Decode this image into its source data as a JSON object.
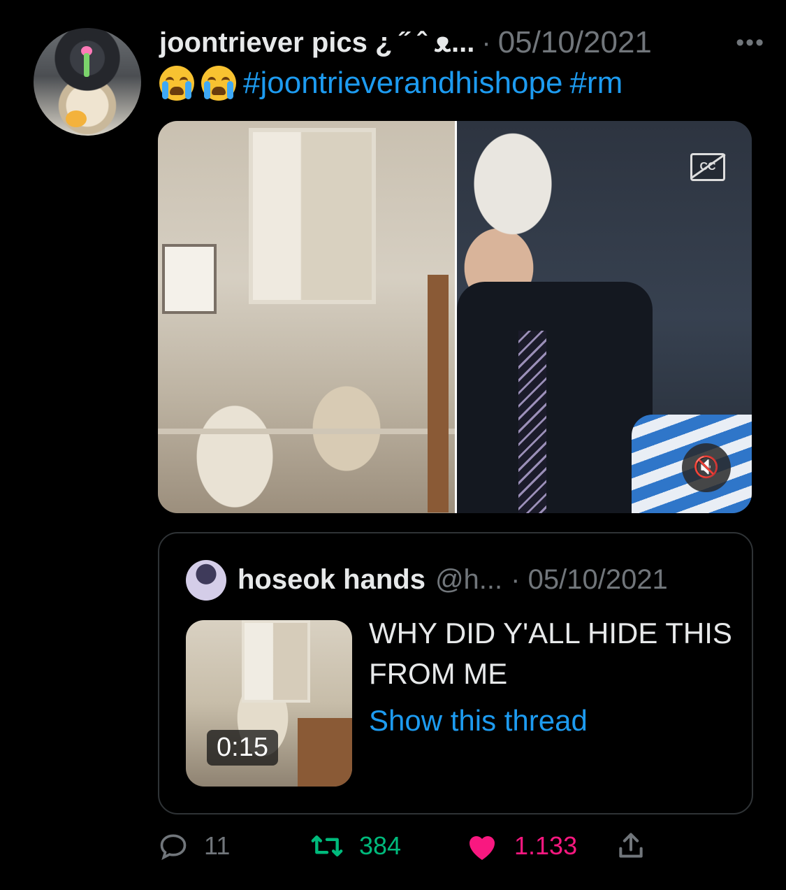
{
  "tweet": {
    "display_name": "joontriever pics ¿ ˝ ˆ ᴥ...",
    "separator": "·",
    "date": "05/10/2021",
    "more_label": "•••",
    "hashtags": [
      "#joontrieverandhishope",
      "#rm"
    ],
    "emoji_icons": [
      "loudly-crying-face-icon",
      "loudly-crying-face-icon"
    ]
  },
  "media": {
    "captions_label": "CC",
    "mute_label": "🔇"
  },
  "quote": {
    "name": "hoseok hands",
    "handle": "@h...",
    "separator": "·",
    "date": "05/10/2021",
    "video_duration": "0:15",
    "text": "WHY DID Y'ALL HIDE THIS FROM ME",
    "thread_link": "Show this thread"
  },
  "actions": {
    "replies": "11",
    "retweets": "384",
    "likes": "1.133"
  },
  "colors": {
    "background": "#000000",
    "text": "#e7e9ea",
    "secondary": "#71767b",
    "link": "#1d9bf0",
    "retweet": "#00ba7c",
    "like": "#f91880",
    "border": "#2f3336"
  }
}
